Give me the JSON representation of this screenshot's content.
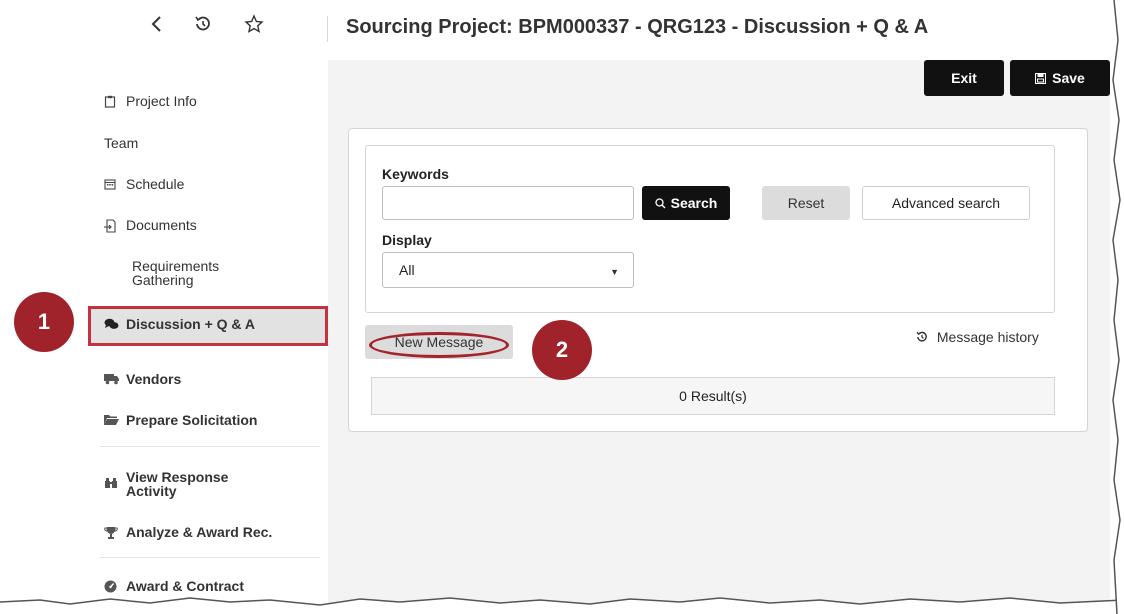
{
  "header": {
    "title": "Sourcing Project: BPM000337 - QRG123 - Discussion + Q & A",
    "icons": [
      "back-icon",
      "history-icon",
      "star-icon"
    ]
  },
  "sidebar": {
    "items": [
      {
        "label": "Project Info",
        "icon": "clipboard-icon"
      },
      {
        "label": "Team",
        "icon": ""
      },
      {
        "label": "Schedule",
        "icon": "calendar-icon"
      },
      {
        "label": "Documents",
        "icon": "document-icon"
      },
      {
        "label": "Requirements Gathering",
        "icon": ""
      },
      {
        "label": "Discussion + Q & A",
        "icon": "chat-icon",
        "active": true
      },
      {
        "label": "Vendors",
        "icon": "truck-icon"
      },
      {
        "label": "Prepare Solicitation",
        "icon": "folder-icon"
      },
      {
        "label": "View Response Activity",
        "icon": "binoculars-icon"
      },
      {
        "label": "Analyze & Award Rec.",
        "icon": "trophy-icon"
      },
      {
        "label": "Award & Contract",
        "icon": "gauge-icon"
      }
    ]
  },
  "toolbar": {
    "exit_label": "Exit",
    "save_label": "Save"
  },
  "search": {
    "keywords_label": "Keywords",
    "keywords_value": "",
    "search_label": "Search",
    "reset_label": "Reset",
    "advanced_label": "Advanced search",
    "display_label": "Display",
    "display_value": "All"
  },
  "messages": {
    "new_message_label": "New Message",
    "history_label": "Message history",
    "results_text": "0 Result(s)"
  },
  "callouts": {
    "one": "1",
    "two": "2"
  },
  "colors": {
    "accent": "#a0232c",
    "primary_button": "#111111"
  }
}
